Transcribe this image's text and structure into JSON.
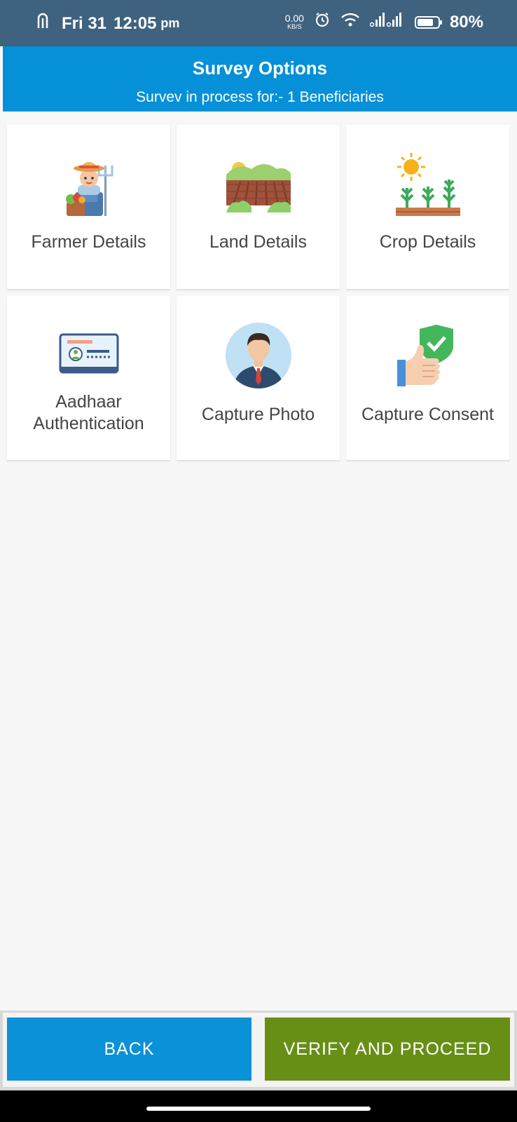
{
  "status_bar": {
    "day_date": "Fri 31",
    "time": "12:05",
    "ampm": "pm",
    "net_speed": "0.00",
    "net_unit": "KB/S",
    "battery": "80%"
  },
  "header": {
    "title": "Survey Options",
    "subtitle": "Survev in process for:- 1 Beneficiaries",
    "bg_color": "#0590d8"
  },
  "options": [
    {
      "label": "Farmer Details",
      "icon": "farmer-icon"
    },
    {
      "label": "Land Details",
      "icon": "land-icon"
    },
    {
      "label": "Crop Details",
      "icon": "crop-icon"
    },
    {
      "label": "Aadhaar Authentication",
      "icon": "id-card-icon"
    },
    {
      "label": "Capture Photo",
      "icon": "person-photo-icon"
    },
    {
      "label": "Capture Consent",
      "icon": "thumbs-up-shield-icon"
    }
  ],
  "buttons": {
    "back": "BACK",
    "verify": "VERIFY AND PROCEED"
  },
  "colors": {
    "status_bar": "#3f627f",
    "back_button": "#0a91d8",
    "verify_button": "#678f16"
  }
}
